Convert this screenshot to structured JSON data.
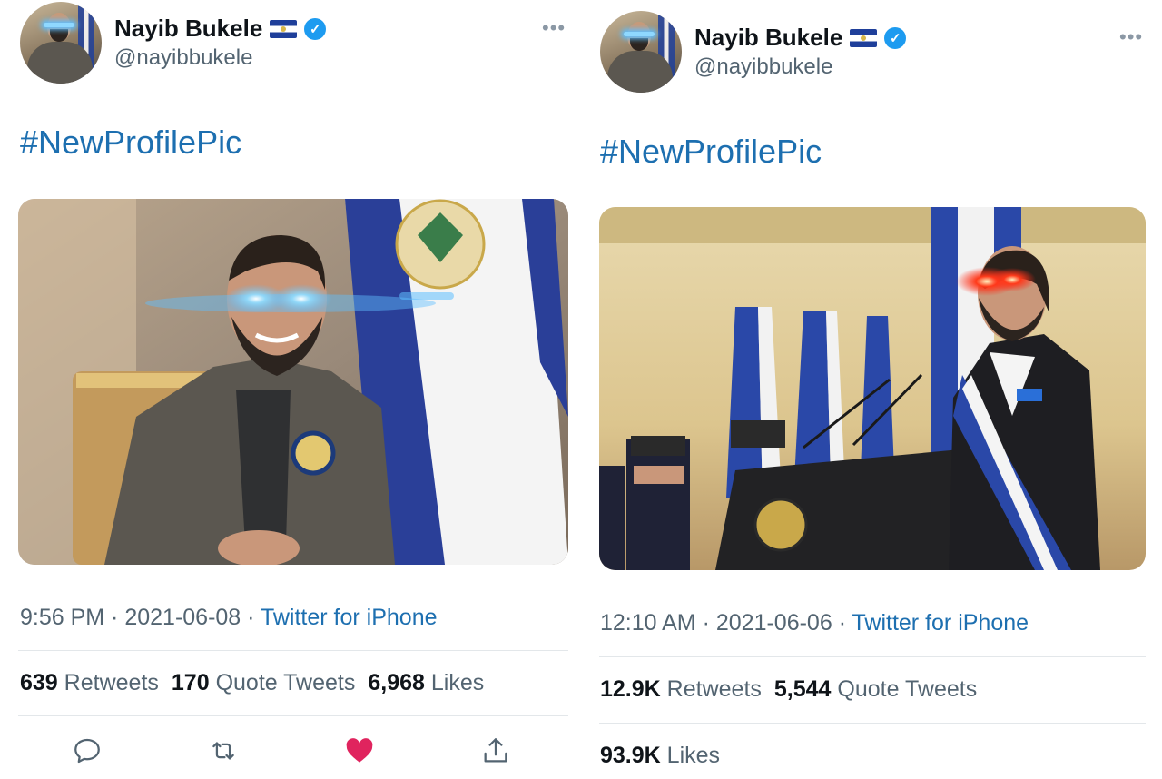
{
  "tweets": [
    {
      "user": {
        "name": "Nayib Bukele",
        "handle": "@nayibbukele",
        "verified_icon": "verified-badge-icon",
        "flag_icon": "el-salvador-flag-icon"
      },
      "more_label": "•••",
      "text": "#NewProfilePic",
      "meta": {
        "time": "9:56 PM",
        "sep1": " · ",
        "date": "2021-06-08",
        "sep2": " · ",
        "source": "Twitter for iPhone"
      },
      "stats": {
        "retweets_count": "639",
        "retweets_label": "Retweets",
        "quotes_count": "170",
        "quotes_label": "Quote Tweets",
        "likes_count": "6,968",
        "likes_label": "Likes"
      },
      "actions": [
        "reply-icon",
        "retweet-icon",
        "like-icon-filled",
        "share-icon"
      ],
      "colors": {
        "like": "#e0245e",
        "link": "#1d6fb0",
        "laser": "#5fbfff"
      }
    },
    {
      "user": {
        "name": "Nayib Bukele",
        "handle": "@nayibbukele",
        "verified_icon": "verified-badge-icon",
        "flag_icon": "el-salvador-flag-icon"
      },
      "more_label": "•••",
      "text": "#NewProfilePic",
      "meta": {
        "time": "12:10 AM",
        "sep1": " · ",
        "date": "2021-06-06",
        "sep2": " · ",
        "source": "Twitter for iPhone"
      },
      "stats": {
        "retweets_count": "12.9K",
        "retweets_label": "Retweets",
        "quotes_count": "5,544",
        "quotes_label": "Quote Tweets",
        "likes_count": "93.9K",
        "likes_label": "Likes"
      },
      "colors": {
        "laser": "#ff2a1a"
      }
    }
  ]
}
